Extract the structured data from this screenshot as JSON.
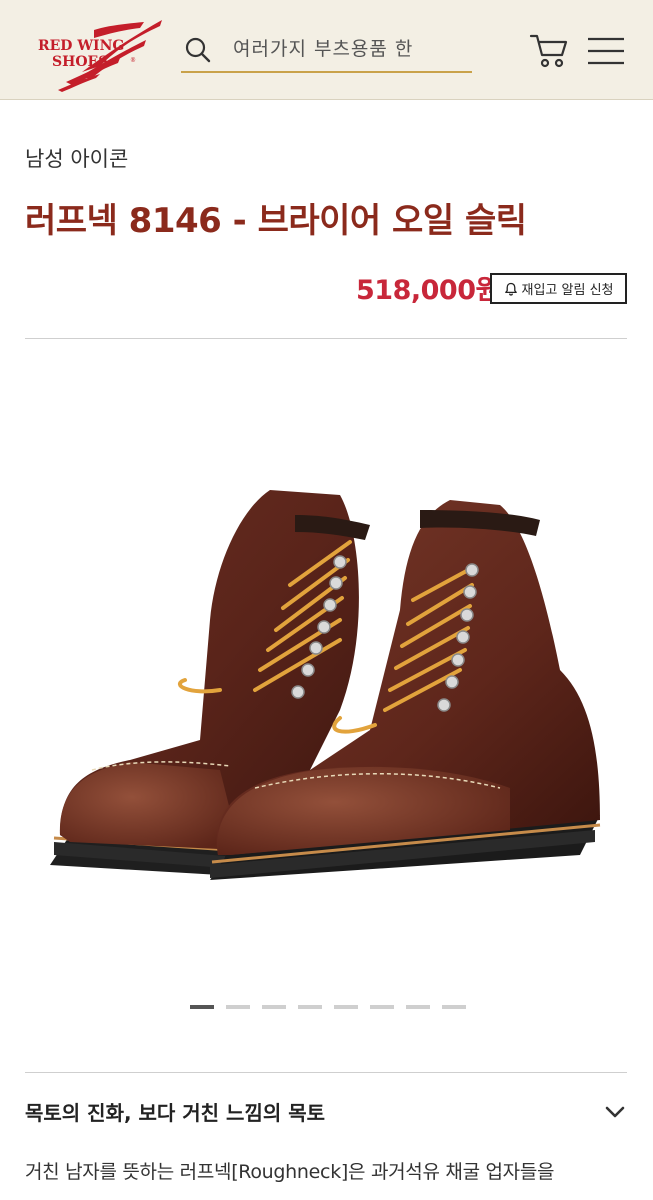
{
  "header": {
    "logo_line1": "RED WING",
    "logo_line2": "SHOES",
    "logo_mark": "®",
    "search_placeholder": "여러가지 부츠용품 한",
    "icons": [
      "search-icon",
      "cart-icon",
      "hamburger-menu-icon"
    ]
  },
  "product": {
    "category": "남성 아이콘",
    "title": "러프넥 8146 - 브라이어 오일 슬릭",
    "price": "518,000원",
    "restock_button": "재입고 알림 신청"
  },
  "carousel": {
    "image_alt": "boots-photo",
    "slide_count": 8,
    "active_index": 0
  },
  "accordion": {
    "title": "목토의 진화, 보다 거친 느낌의 목토"
  },
  "description": "거친 남자를 뜻하는 러프넥[Roughneck]은 과거석유 채굴 업자들을",
  "colors": {
    "brand_red": "#8b2a1c",
    "price_red": "#c8273a",
    "header_bg": "#f3efe4",
    "accent_gold": "#c9a24a"
  }
}
